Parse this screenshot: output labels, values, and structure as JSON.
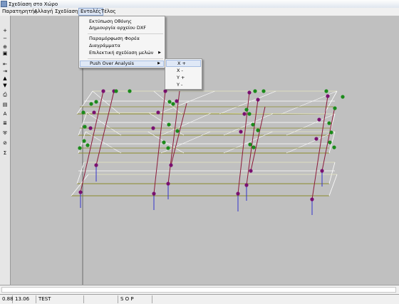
{
  "window": {
    "title": "Σχεδίαση στο Χώρο"
  },
  "menubar": {
    "items": [
      {
        "label": "Παρατηρητής"
      },
      {
        "label": "Αλλαγή"
      },
      {
        "label": "Σχεδίαση"
      },
      {
        "label": "Εντολές"
      },
      {
        "label": "Τέλος"
      }
    ]
  },
  "dropdown": {
    "items": [
      {
        "label": "Εκτύπωση Οθόνης"
      },
      {
        "label": "Δημιουργία αρχείου DXF"
      },
      {
        "label": "Παραμόρφωση Φορέα"
      },
      {
        "label": "Διαγράμματα"
      },
      {
        "label": "Επιλεκτική σχεδίαση μελών",
        "arrow": "▶"
      },
      {
        "label": "Push Over Analysis",
        "arrow": "▶"
      }
    ]
  },
  "submenu": {
    "items": [
      {
        "label": "X +"
      },
      {
        "label": "X -"
      },
      {
        "label": "Y +"
      },
      {
        "label": "Y -"
      }
    ]
  },
  "toolbar": {
    "icons": [
      "+",
      "−",
      "⊕",
      "▣",
      "⇤",
      "⇥",
      "▲",
      "▼",
      "⎙",
      "▤",
      "A",
      "≣",
      "⛨",
      "⊘",
      "Σ"
    ]
  },
  "status": {
    "x": "0.88",
    "y": "13.06",
    "name": "TEST",
    "mode": "S O P"
  },
  "colors": {
    "grid": "#ffffff",
    "beam": "#8a8a2a",
    "column": "#8b1a3a",
    "node_purple": "#7a1070",
    "node_green": "#1a8a1a",
    "support": "#3333cc"
  }
}
